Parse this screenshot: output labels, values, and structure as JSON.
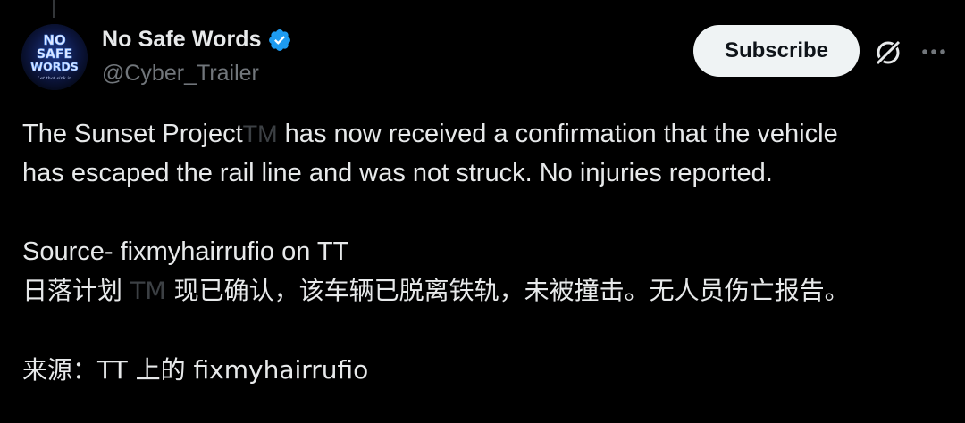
{
  "author": {
    "display_name": "No Safe Words",
    "handle": "@Cyber_Trailer",
    "avatar_text": [
      "NO",
      "SAFE",
      "WORDS"
    ],
    "avatar_tagline": "Let that sink in",
    "verified": true,
    "verified_color": "#1d9bf0"
  },
  "actions": {
    "subscribe_label": "Subscribe",
    "grok_icon": "grok-icon",
    "more_icon": "more-icon"
  },
  "tweet": {
    "line1_a": "The Sunset Project",
    "tm": "TM",
    "line1_b": " has now received a confirmation that the vehicle",
    "line2": "has escaped the rail line and was not struck.  No injuries reported.",
    "source": "Source-  fixmyhairrufio on TT",
    "zh_a": "日落计划 ",
    "zh_tm": "TM",
    "zh_b": " 现已确认，该车辆已脱离铁轨，未被撞击。无人员伤亡报告。",
    "zh_source": "来源：TT 上的 fixmyhairrufio"
  },
  "colors": {
    "background": "#000000",
    "text_primary": "#e7e9ea",
    "text_secondary": "#71767b",
    "button_bg": "#eff3f4",
    "button_text": "#0f1419"
  }
}
